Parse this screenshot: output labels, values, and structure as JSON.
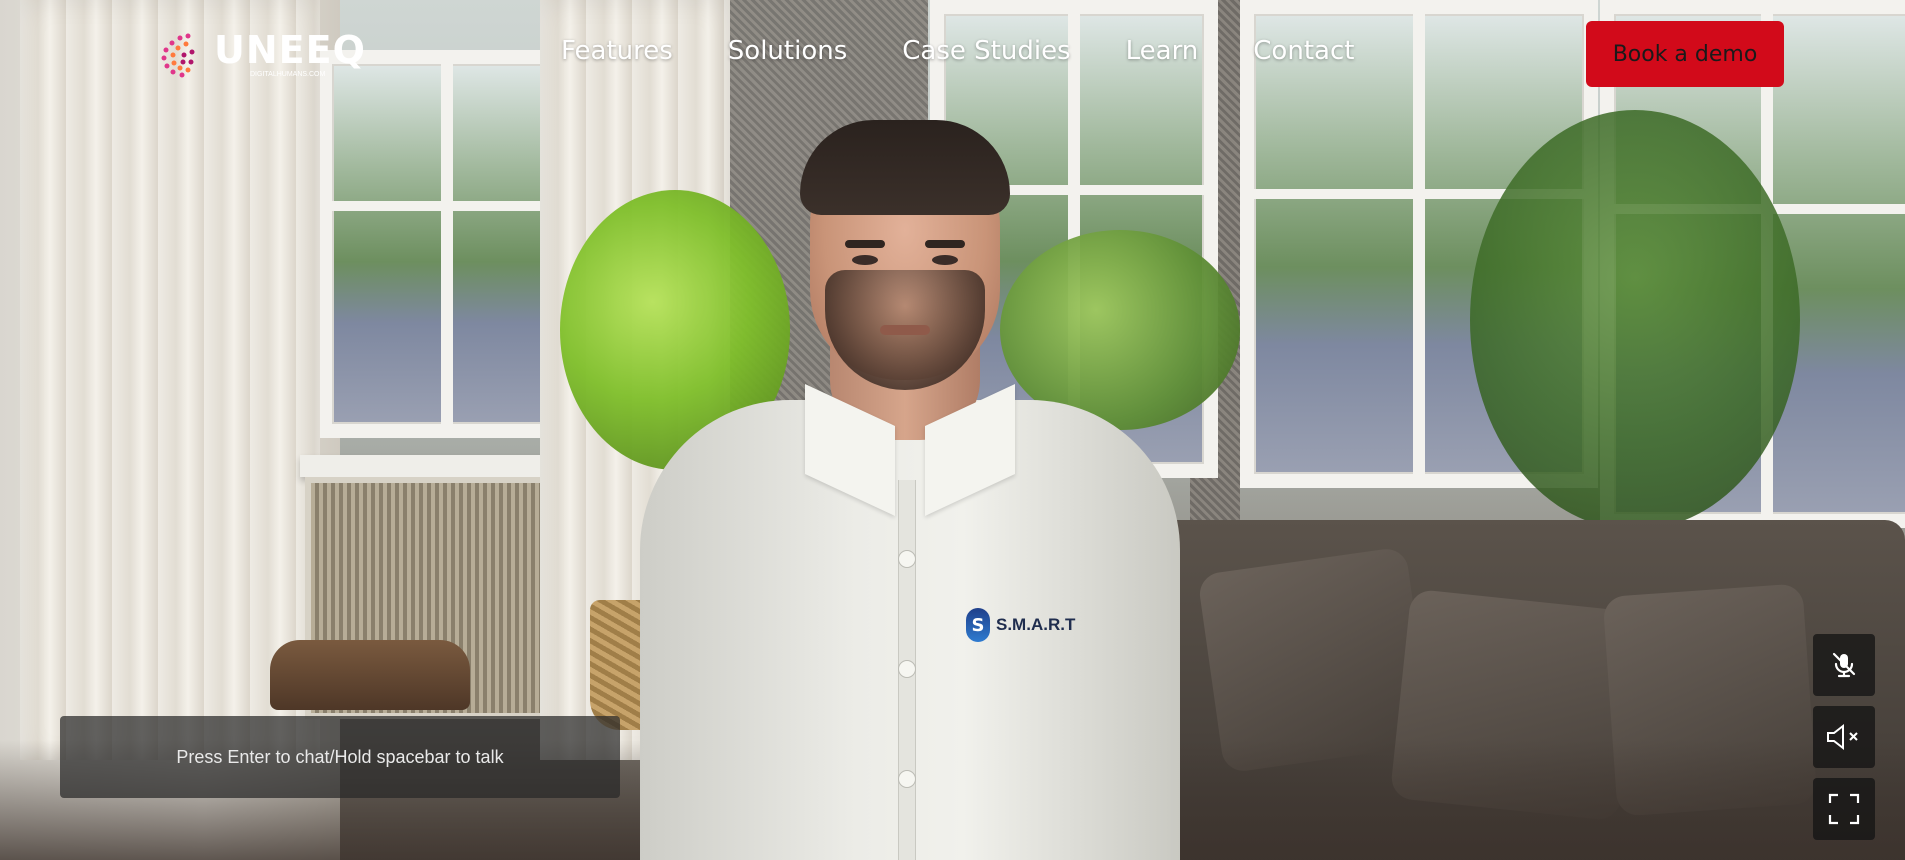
{
  "header": {
    "brand": {
      "name": "UNEEQ",
      "tagline": "DIGITALHUMANS.COM"
    },
    "nav": [
      {
        "label": "Features"
      },
      {
        "label": "Solutions"
      },
      {
        "label": "Case Studies"
      },
      {
        "label": "Learn"
      },
      {
        "label": "Contact"
      }
    ],
    "cta_label": "Book a demo",
    "cta_color": "#d20a1a"
  },
  "avatar": {
    "shirt_logo_text": "S.M.A.R.T"
  },
  "chat": {
    "prompt": "Press Enter to chat/Hold spacebar to talk"
  },
  "controls": [
    {
      "icon": "mic-off-icon"
    },
    {
      "icon": "speaker-muted-icon"
    },
    {
      "icon": "fullscreen-icon"
    }
  ]
}
